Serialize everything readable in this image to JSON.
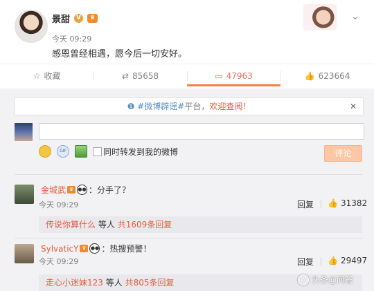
{
  "post": {
    "author": "景甜",
    "time": "今天 09:29",
    "text": "感恩曾经相遇，愿今后一切安好。"
  },
  "actions": {
    "favorite_label": "收藏",
    "repost_count": "85658",
    "comment_count": "47963",
    "like_count": "623664"
  },
  "notice": {
    "hashtag": "#微博辟谣#",
    "platform": "平台，",
    "welcome": "欢迎查阅！"
  },
  "composer": {
    "repost_label": "同时转发到我的微博",
    "submit_label": "评论",
    "input_value": ""
  },
  "comments": [
    {
      "user": "金城武",
      "text": "：分手了？",
      "time": "今天 09:29",
      "reply_label": "回复",
      "likes": "31382",
      "sub_first": "传说你算什么",
      "sub_mid": "等人",
      "sub_total": "共1609条回复"
    },
    {
      "user": "SylvaticY",
      "text": "：热搜预警！",
      "time": "今天 09:29",
      "reply_label": "回复",
      "likes": "29497",
      "sub_first": "走心小迷妹123",
      "sub_mid": "等人",
      "sub_total": "共805条回复"
    }
  ],
  "watermark": "头条@问答",
  "colors": {
    "accent": "#fa7d3c",
    "username": "#e65c3c",
    "link_blue": "#5a8fc0",
    "background_gray": "#f2f2f5"
  },
  "icons": {
    "favorite": "star-icon",
    "repost": "repost-icon",
    "comment": "comment-icon",
    "like": "thumb-up-icon",
    "close": "close-icon"
  }
}
